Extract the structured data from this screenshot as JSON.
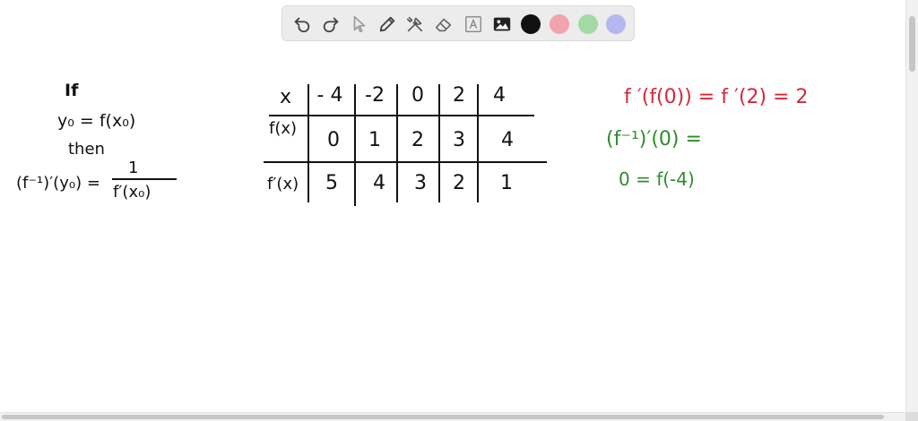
{
  "toolbar": {
    "tools": [
      "undo-icon",
      "redo-icon",
      "select-pointer-icon",
      "pen-icon",
      "tools-icon",
      "eraser-icon",
      "text-icon",
      "image-icon"
    ],
    "colors": [
      "#111111",
      "#f2a3ad",
      "#a3d9a3",
      "#b3b8ee"
    ]
  },
  "notes": {
    "left": {
      "line1": "If",
      "line2": "y₀ = f(x₀)",
      "line3": "then",
      "formula_lhs": "(f⁻¹)′(y₀) =",
      "numerator": "1",
      "denominator": "f′(x₀)"
    },
    "table": {
      "row_labels": [
        "x",
        "f(x)",
        "f′(x)"
      ],
      "x": [
        "- 4",
        "-2",
        "0",
        "2",
        "4"
      ],
      "f": [
        "0",
        "1",
        "2",
        "3",
        "4"
      ],
      "fprime": [
        "5",
        "4",
        "3",
        "2",
        "1"
      ]
    },
    "right": {
      "red_line": "f ′(f(0)) = f ′(2) = 2",
      "green_line1": "(f⁻¹)′(0) =",
      "green_line2": "0 = f(-4)"
    }
  }
}
